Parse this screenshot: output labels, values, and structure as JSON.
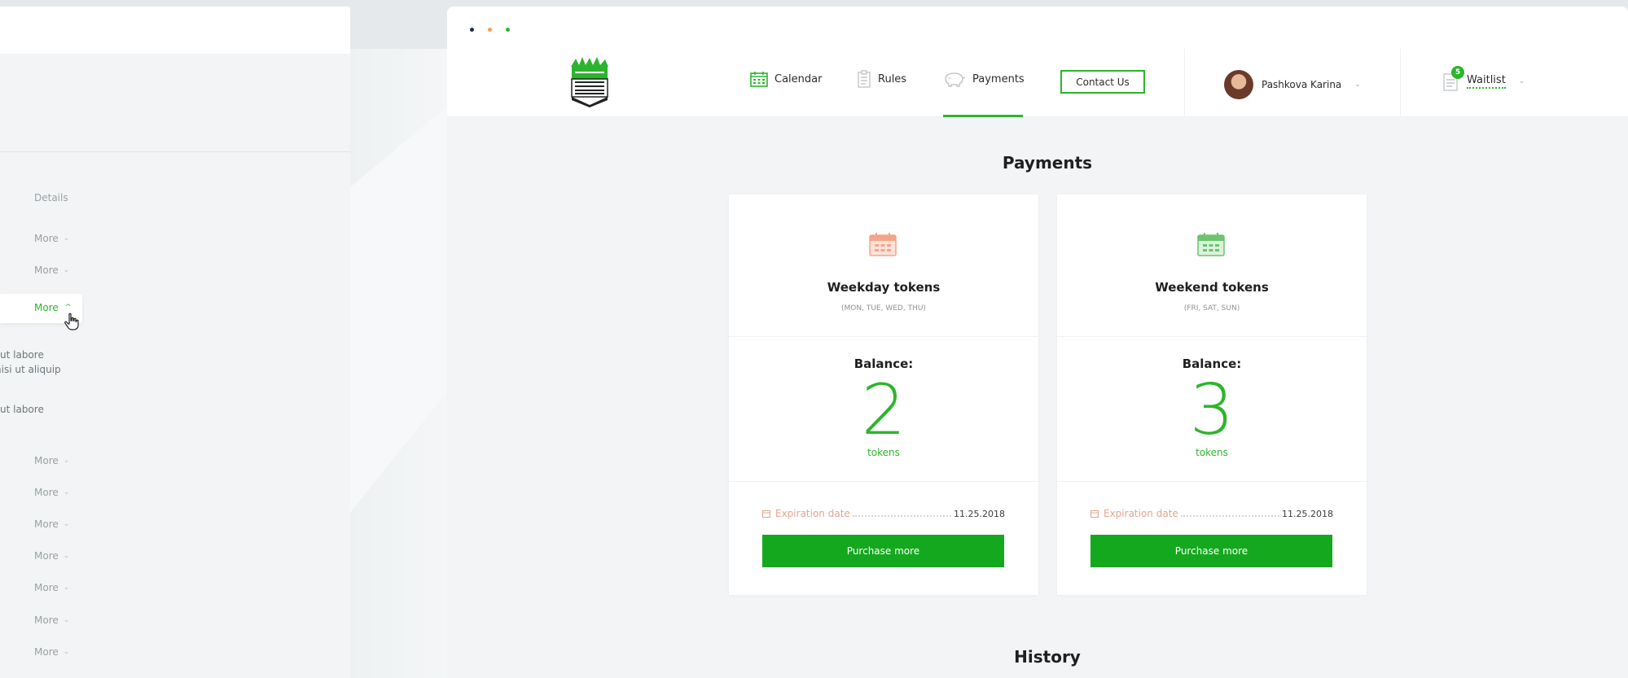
{
  "left_panel": {
    "details_label": "Details",
    "more_label": "More",
    "text_lines": [
      "ut labore",
      "nisi ut aliquip",
      "ut labore"
    ]
  },
  "header": {
    "nav": {
      "calendar": "Calendar",
      "rules": "Rules",
      "payments": "Payments"
    },
    "contact_button": "Contact Us",
    "user_name": "Pashkova Karina",
    "waitlist_label": "Waitlist",
    "waitlist_badge": "5"
  },
  "colors": {
    "accent": "#2cb52c",
    "button": "#14a81e",
    "weekday_icon": "#f5a48a",
    "weekend_icon": "#6cc46c"
  },
  "payments": {
    "title": "Payments",
    "cards": [
      {
        "title": "Weekday tokens",
        "days": "(MON, TUE, WED, THU)",
        "balance_label": "Balance:",
        "balance": "2",
        "unit": "tokens",
        "expiration_label": "Expiration date",
        "expiration_date": "11.25.2018",
        "button": "Purchase more",
        "icon": "calendar-icon"
      },
      {
        "title": "Weekend tokens",
        "days": "(FRI, SAT, SUN)",
        "balance_label": "Balance:",
        "balance": "3",
        "unit": "tokens",
        "expiration_label": "Expiration date",
        "expiration_date": "11.25.2018",
        "button": "Purchase more",
        "icon": "calendar-icon"
      }
    ]
  },
  "history": {
    "title": "History"
  }
}
